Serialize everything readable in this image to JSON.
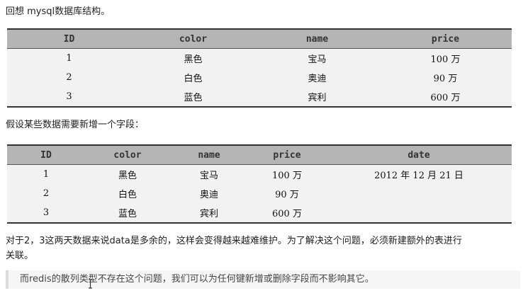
{
  "intro": "回想 mysql数据库结构。",
  "table1": {
    "headers": [
      "ID",
      "color",
      "name",
      "price"
    ],
    "rows": [
      [
        "1",
        "黑色",
        "宝马",
        "100 万"
      ],
      [
        "2",
        "白色",
        "奥迪",
        "90 万"
      ],
      [
        "3",
        "蓝色",
        "宾利",
        "600 万"
      ]
    ]
  },
  "para2": "假设某些数据需要新增一个字段：",
  "table2": {
    "headers": [
      "ID",
      "color",
      "name",
      "price",
      "date"
    ],
    "rows": [
      [
        "1",
        "黑色",
        "宝马",
        "100 万",
        "2012 年 12 月 21 日"
      ],
      [
        "2",
        "白色",
        "奥迪",
        "90 万",
        ""
      ],
      [
        "3",
        "蓝色",
        "宾利",
        "600 万",
        ""
      ]
    ]
  },
  "para3_line1": "对于2，3这两天数据来说data是多余的，这样会变得越来越难维护。为了解决这个问题，必须新建额外的表进行",
  "para3_line2": "关联。",
  "note": "而redis的散列类型不存在这个问题，我们可以为任何键新增或删除字段而不影响其它。"
}
